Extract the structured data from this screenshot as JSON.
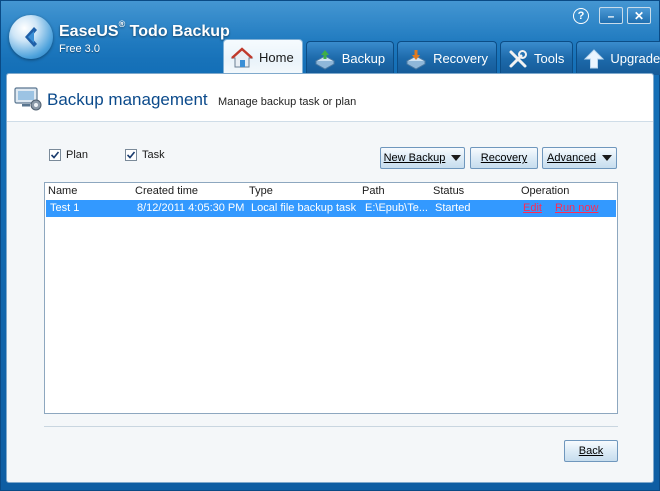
{
  "app": {
    "name": "EaseUS",
    "name_sup": "®",
    "name_rest": " Todo Backup",
    "edition": "Free 3.0"
  },
  "window_controls": {
    "help": "?",
    "minimize": "–",
    "close": "✕"
  },
  "tabs": [
    {
      "label": "Home",
      "icon": "home-icon",
      "active": true
    },
    {
      "label": "Backup",
      "icon": "backup-icon",
      "active": false
    },
    {
      "label": "Recovery",
      "icon": "recovery-icon",
      "active": false
    },
    {
      "label": "Tools",
      "icon": "tools-icon",
      "active": false
    },
    {
      "label": "Upgrade",
      "icon": "upgrade-arrow-icon",
      "active": false
    }
  ],
  "page": {
    "title": "Backup management",
    "subtitle": "Manage backup task or plan"
  },
  "filters": {
    "plan": {
      "label": "Plan",
      "checked": true
    },
    "task": {
      "label": "Task",
      "checked": true
    }
  },
  "toolbar": {
    "new_backup": "New Backup",
    "recovery": "Recovery",
    "advanced": "Advanced"
  },
  "table": {
    "columns": [
      "Name",
      "Created time",
      "Type",
      "Path",
      "Status",
      "Operation"
    ],
    "rows": [
      {
        "name": "Test 1",
        "created": "8/12/2011 4:05:30 PM",
        "type": "Local file backup task",
        "path": "E:\\Epub\\Te...",
        "status": "Started",
        "op_edit": "Edit",
        "op_run": "Run now",
        "selected": true
      }
    ]
  },
  "footer": {
    "back": "Back"
  },
  "colors": {
    "frame": "#1470b8",
    "selection": "#3399ff",
    "link": "#ff2a55",
    "title": "#0b4a8b"
  }
}
